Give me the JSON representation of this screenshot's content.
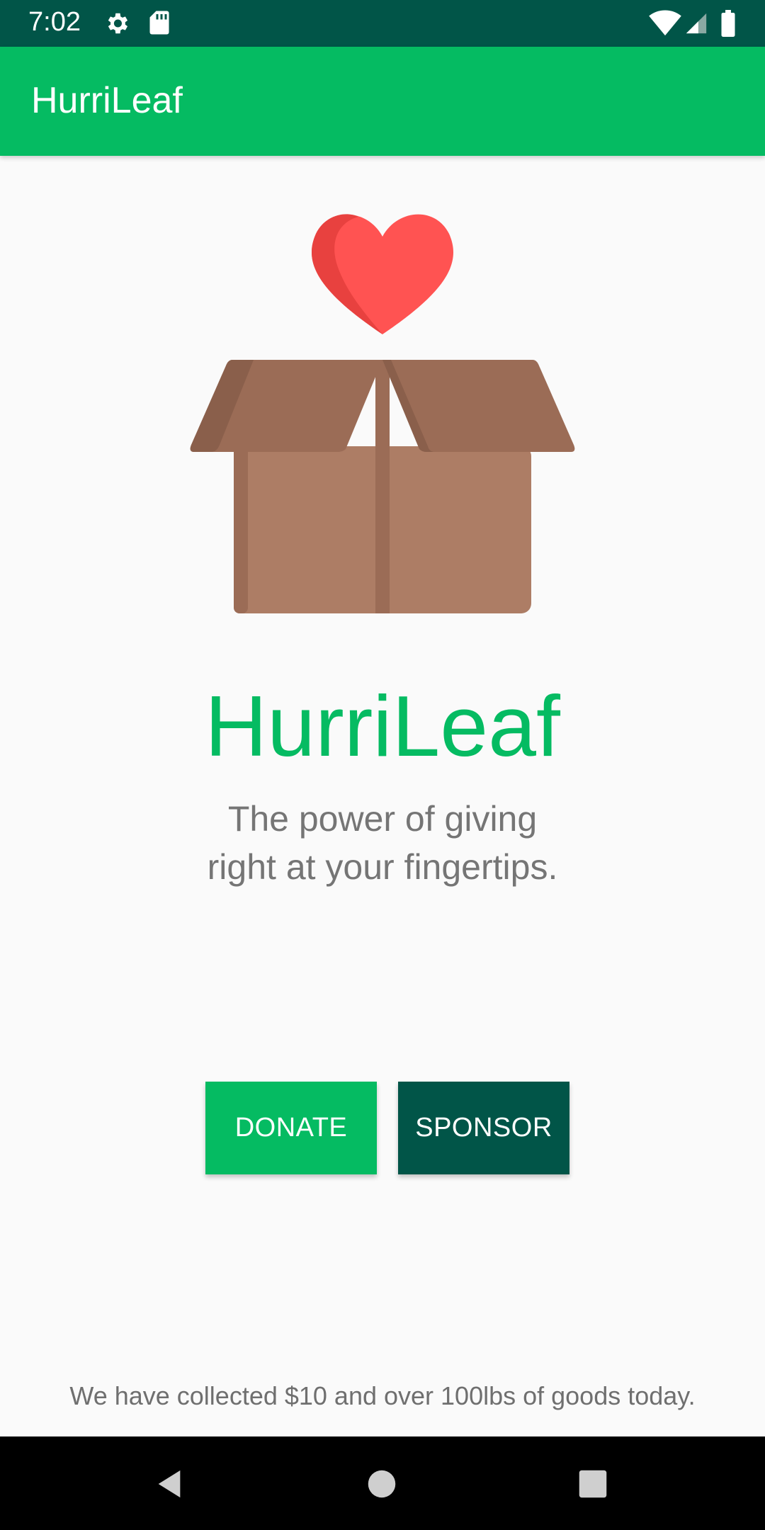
{
  "status_bar": {
    "time": "7:02",
    "icons": [
      "gear-icon",
      "sd-card-icon",
      "wifi-icon",
      "cell-signal-icon",
      "battery-icon"
    ]
  },
  "app_bar": {
    "title": "HurriLeaf"
  },
  "hero": {
    "icon": "heart-box-illustration"
  },
  "main": {
    "brand_title": "HurriLeaf",
    "tagline_line1": "The power of giving",
    "tagline_line2": "right at your fingertips."
  },
  "actions": {
    "donate_label": "DONATE",
    "sponsor_label": "SPONSOR"
  },
  "footer": {
    "stats_text": "We have collected $10 and over 100lbs of goods today."
  },
  "nav_bar": {
    "icons": [
      "back-icon",
      "home-icon",
      "recents-icon"
    ]
  },
  "colors": {
    "primary": "#05bb62",
    "primary_dark": "#015548",
    "heart": "#ff5352",
    "box": "#ad7d65",
    "text_secondary": "#757575"
  }
}
